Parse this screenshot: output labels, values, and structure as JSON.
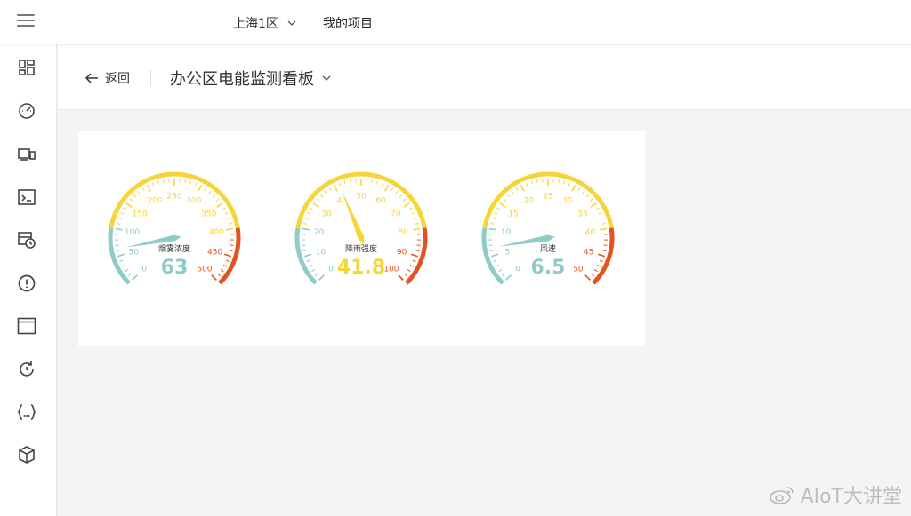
{
  "header": {
    "region_label": "上海1区",
    "project_label": "我的项目"
  },
  "sidebar": {
    "items": [
      {
        "icon": "dashboard-grid-icon"
      },
      {
        "icon": "speedometer-icon"
      },
      {
        "icon": "devices-icon"
      },
      {
        "icon": "terminal-icon"
      },
      {
        "icon": "schedule-icon"
      },
      {
        "icon": "alert-icon"
      },
      {
        "icon": "window-icon"
      },
      {
        "icon": "refresh-icon"
      },
      {
        "icon": "code-braces-icon"
      },
      {
        "icon": "package-icon"
      }
    ]
  },
  "subheader": {
    "back_label": "返回",
    "board_title": "办公区电能监测看板"
  },
  "gauges": [
    {
      "name": "烟雾浓度",
      "value": 63,
      "value_text": "63",
      "min": 0,
      "max": 500,
      "ticks": [
        0,
        50,
        100,
        150,
        200,
        250,
        300,
        350,
        400,
        450,
        500
      ],
      "value_color": "#8fcbc7"
    },
    {
      "name": "降雨强度",
      "value": 41.8,
      "value_text": "41.8",
      "min": 0,
      "max": 100,
      "ticks": [
        0,
        10,
        20,
        30,
        40,
        50,
        60,
        70,
        80,
        90,
        100
      ],
      "value_color": "#f6d53b"
    },
    {
      "name": "风速",
      "value": 6.5,
      "value_text": "6.5",
      "min": 0,
      "max": 50,
      "ticks": [
        0,
        5,
        10,
        15,
        20,
        25,
        30,
        35,
        40,
        45,
        50
      ],
      "value_color": "#8fcbc7"
    }
  ],
  "colors": {
    "band_low": "#8fcbc7",
    "band_mid": "#f6d53b",
    "band_high": "#e0551f"
  },
  "watermark": "AIoT大讲堂"
}
